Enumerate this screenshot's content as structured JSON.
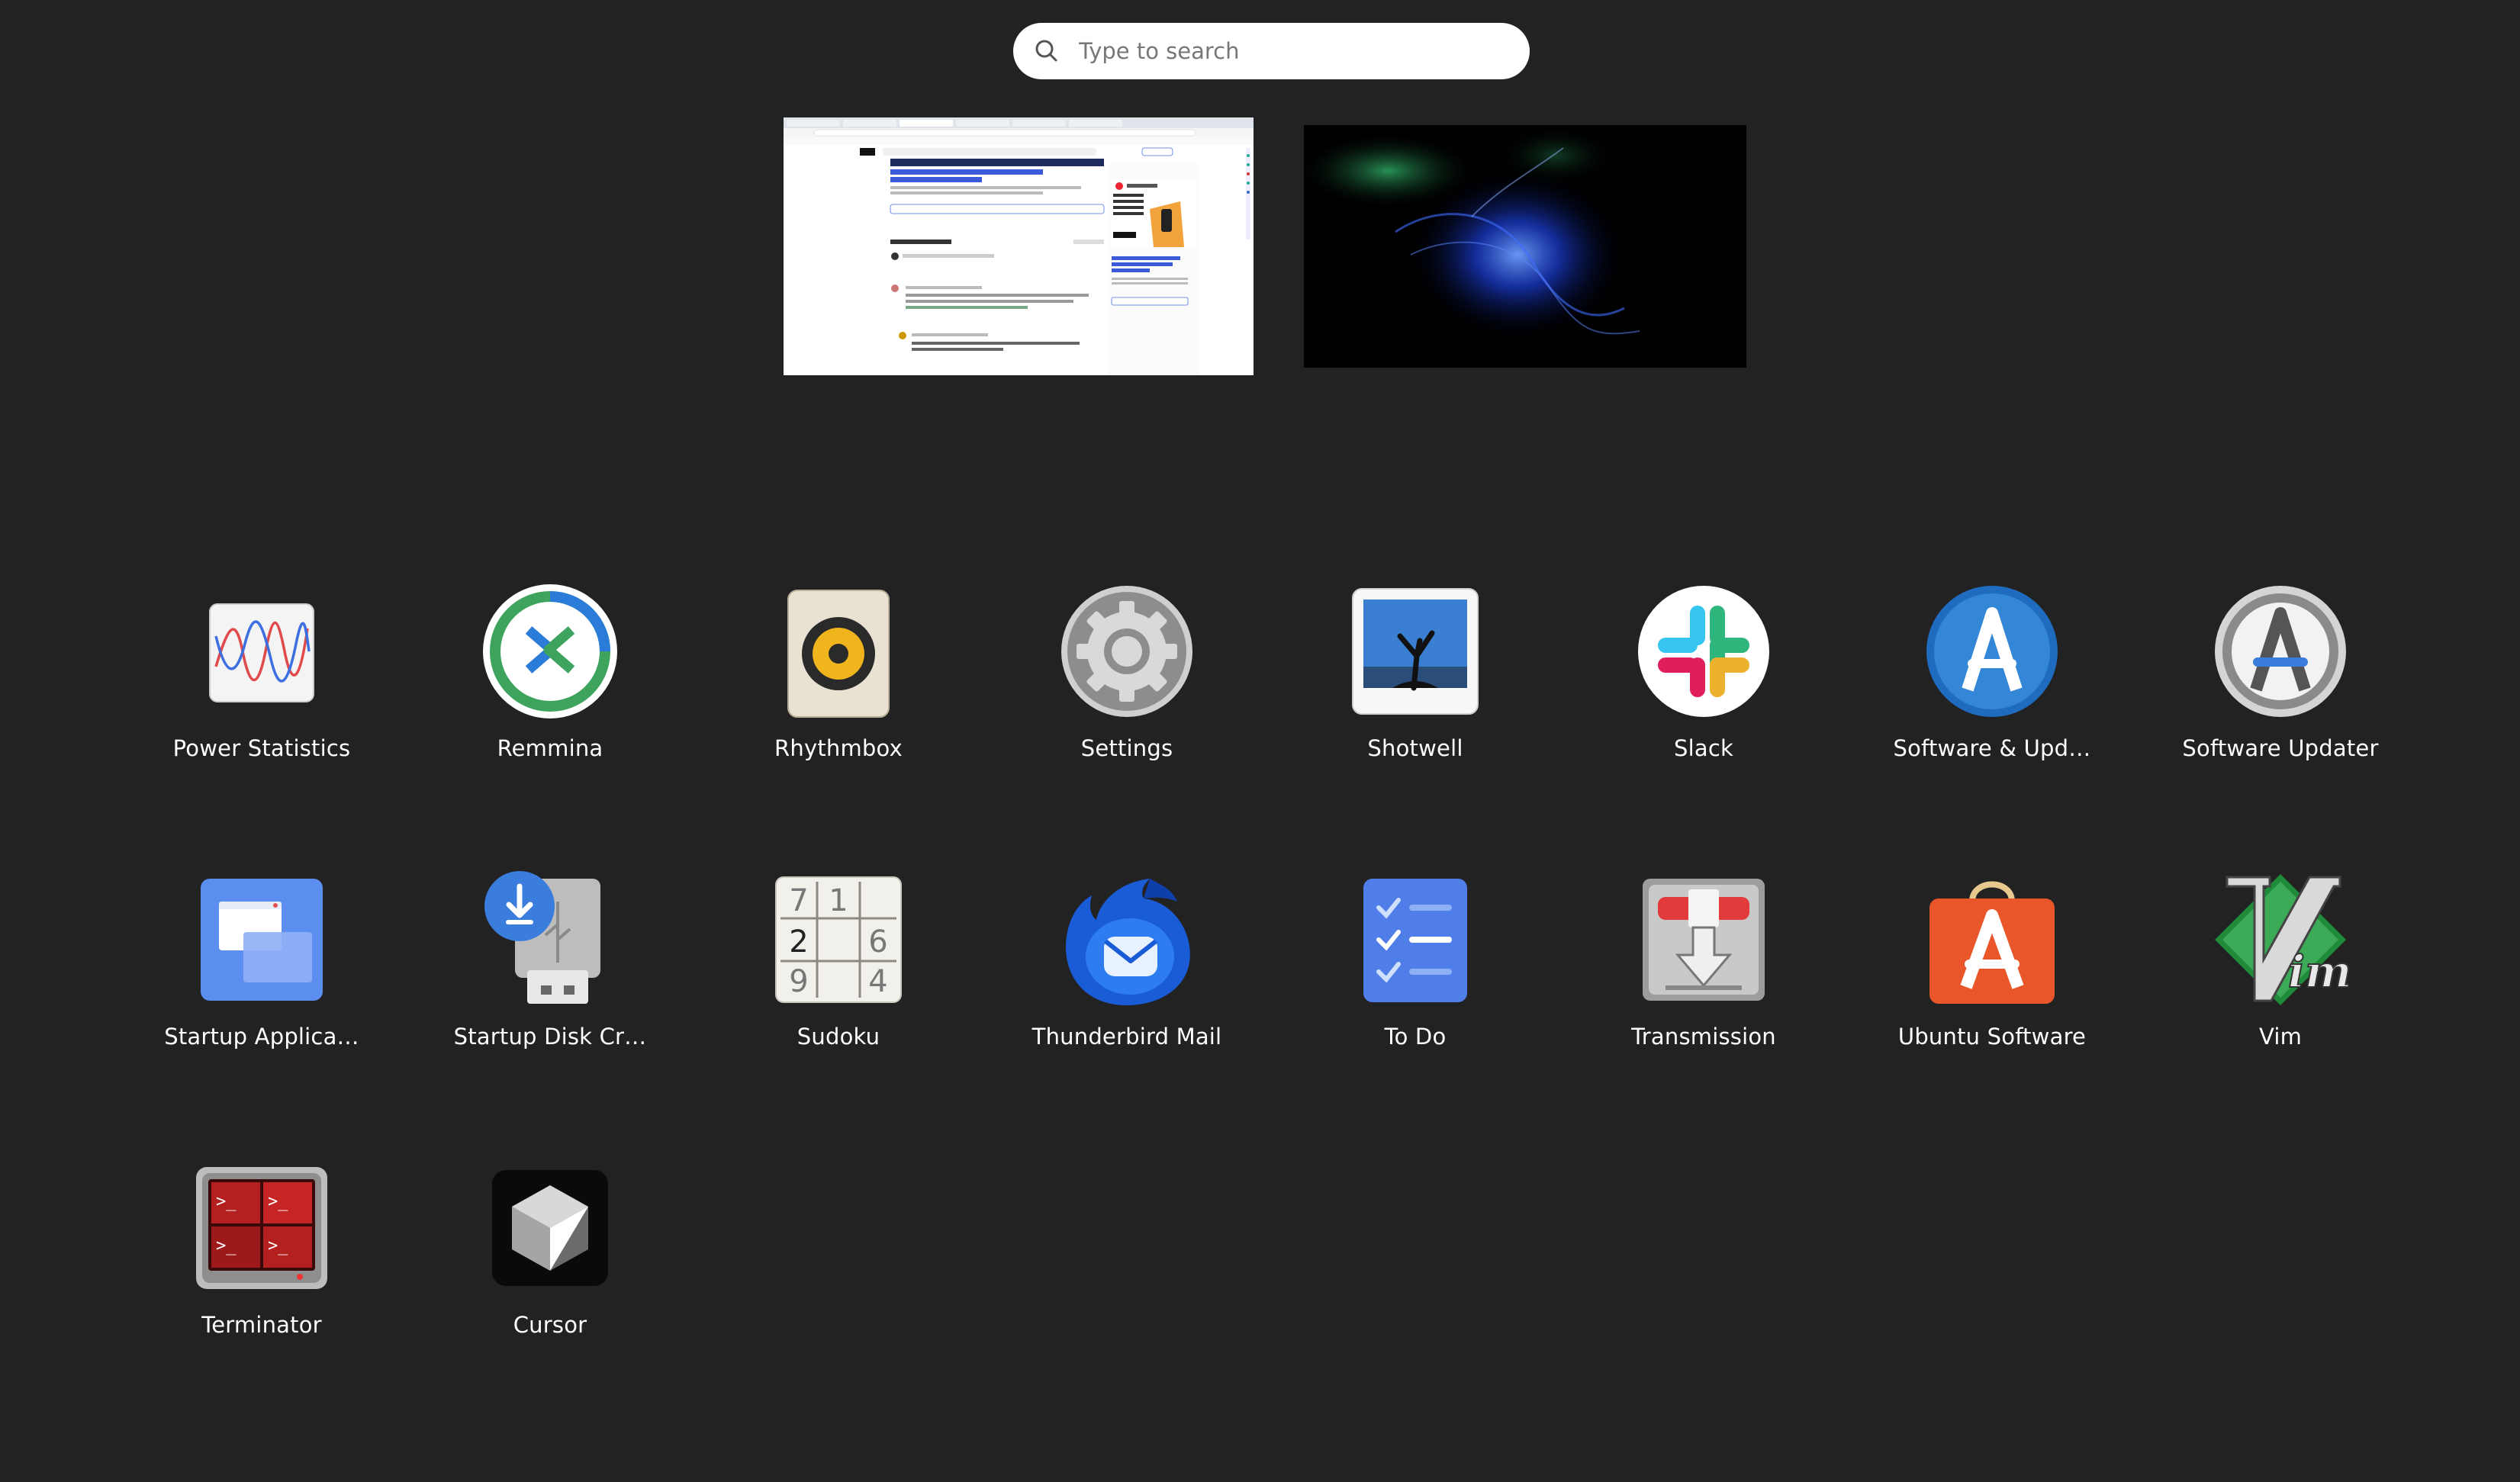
{
  "search": {
    "placeholder": "Type to search"
  },
  "workspace_preview": {
    "headline": "Feed Your Models Real-Time Data – Enhance your AI with up-to-the-minute data.",
    "comments_title": "Top comments (40)",
    "ad_headline": "Realm regret? Switch to Couchbase Mobile."
  },
  "apps": [
    {
      "label": "Power Statistics",
      "icon": "power-statistics-icon"
    },
    {
      "label": "Remmina",
      "icon": "remmina-icon"
    },
    {
      "label": "Rhythmbox",
      "icon": "rhythmbox-icon"
    },
    {
      "label": "Settings",
      "icon": "settings-gear-icon"
    },
    {
      "label": "Shotwell",
      "icon": "shotwell-icon"
    },
    {
      "label": "Slack",
      "icon": "slack-icon"
    },
    {
      "label": "Software & Upd…",
      "icon": "software-updates-icon"
    },
    {
      "label": "Software Updater",
      "icon": "software-updater-icon"
    },
    {
      "label": "Startup Applica…",
      "icon": "startup-applications-icon"
    },
    {
      "label": "Startup Disk Cr…",
      "icon": "startup-disk-creator-icon"
    },
    {
      "label": "Sudoku",
      "icon": "sudoku-icon"
    },
    {
      "label": "Thunderbird Mail",
      "icon": "thunderbird-icon"
    },
    {
      "label": "To Do",
      "icon": "todo-icon"
    },
    {
      "label": "Transmission",
      "icon": "transmission-icon"
    },
    {
      "label": "Ubuntu Software",
      "icon": "ubuntu-software-icon"
    },
    {
      "label": "Vim",
      "icon": "vim-icon"
    },
    {
      "label": "Terminator",
      "icon": "terminator-icon"
    },
    {
      "label": "Cursor",
      "icon": "cursor-icon"
    }
  ],
  "colors": {
    "background": "#222222",
    "label": "#ffffff",
    "search_bg": "#ffffff"
  }
}
